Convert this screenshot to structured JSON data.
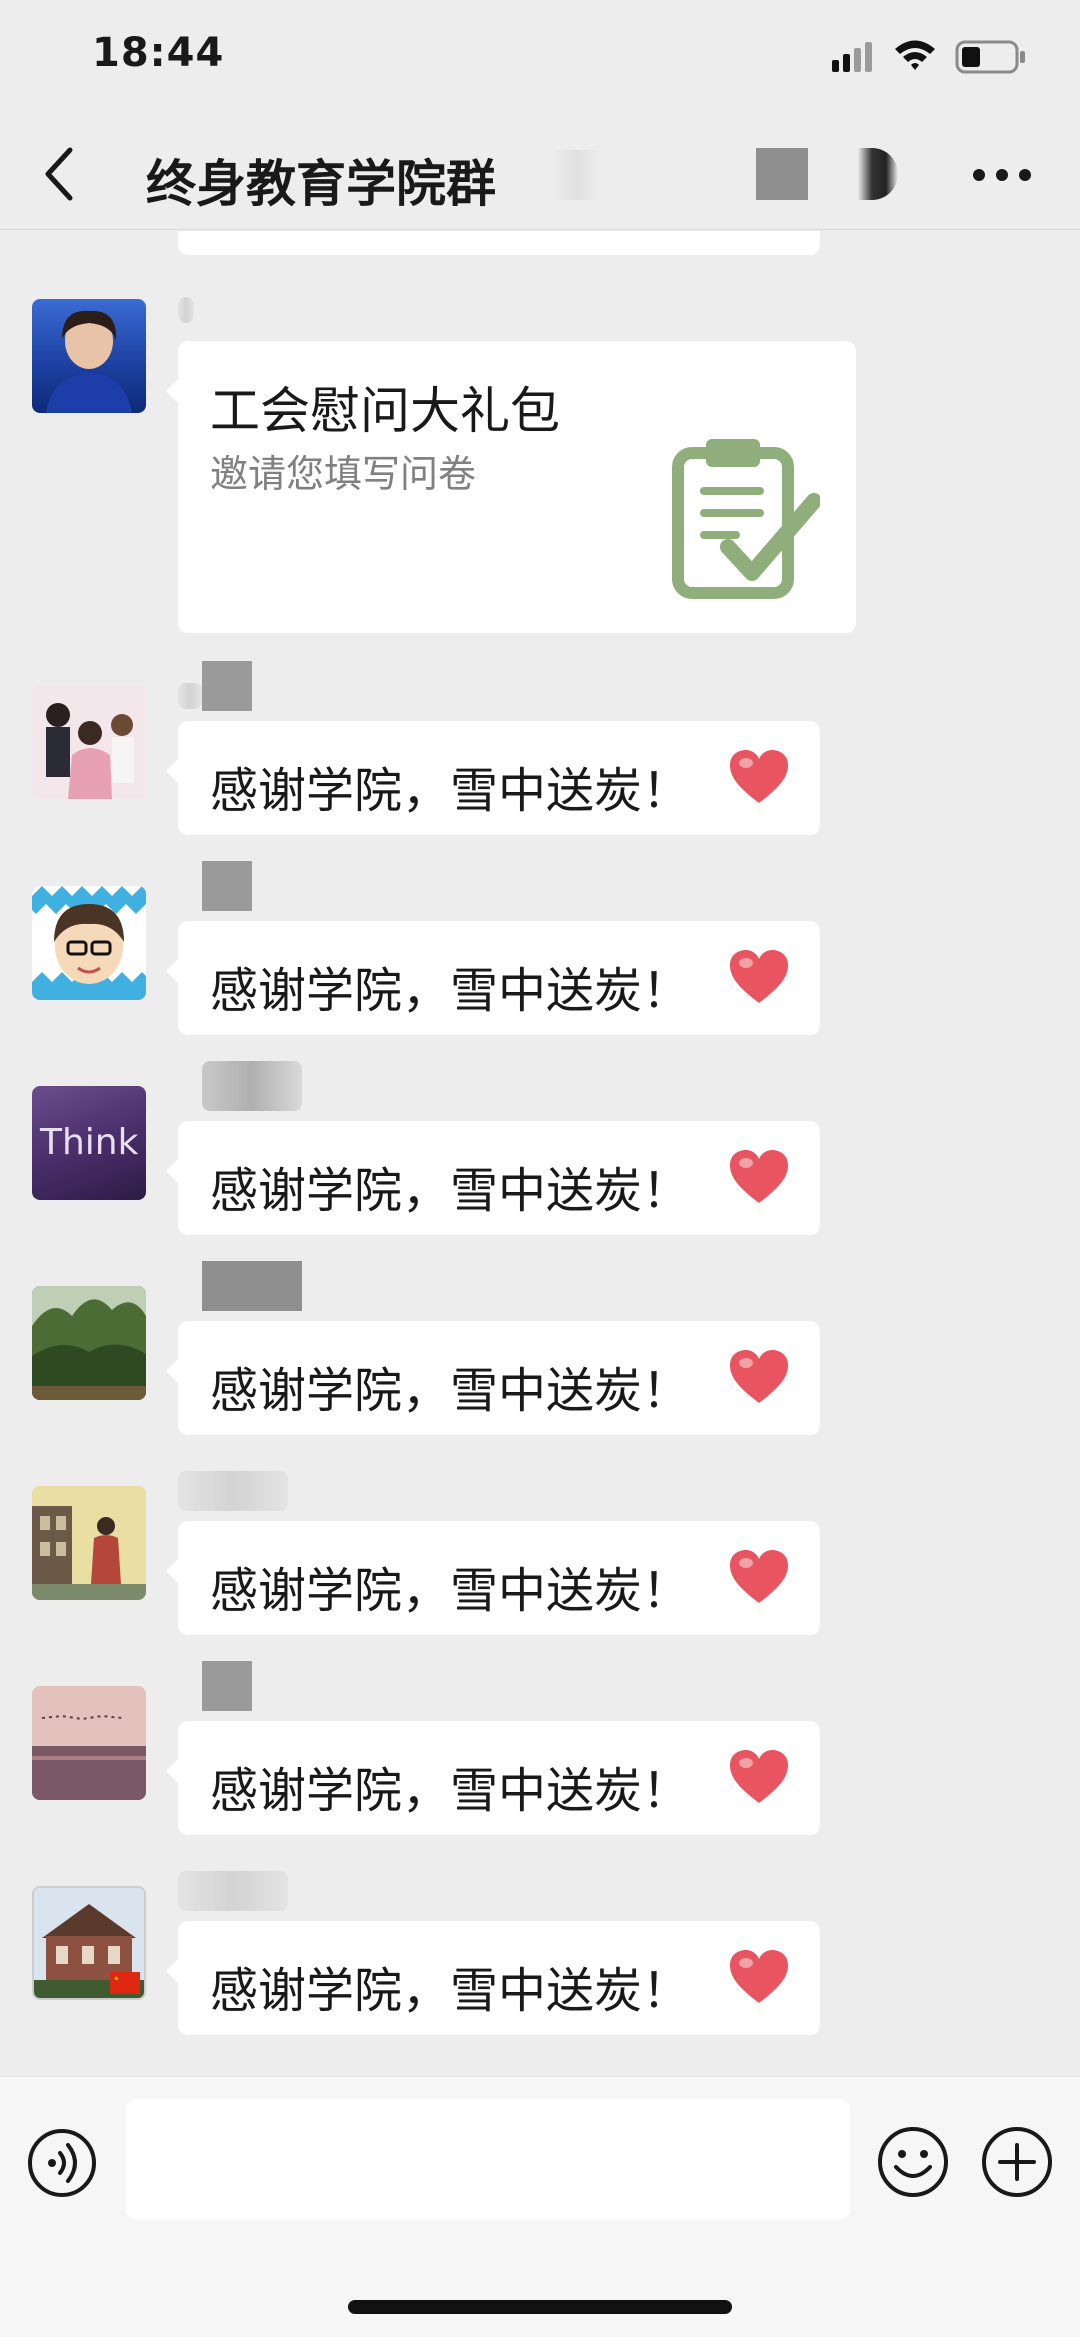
{
  "status_bar": {
    "time": "18:44"
  },
  "nav": {
    "title": "终身教育学院群"
  },
  "card_message": {
    "title": "工会慰问大礼包",
    "subtitle": "邀请您填写问卷",
    "icon": "clipboard-check-icon",
    "icon_color": "#8fae7c"
  },
  "messages": [
    {
      "text": "感谢学院，雪中送炭！",
      "emoji": "heart-icon"
    },
    {
      "text": "感谢学院，雪中送炭！",
      "emoji": "heart-icon"
    },
    {
      "text": "感谢学院，雪中送炭！",
      "emoji": "heart-icon",
      "avatar_text": "Think"
    },
    {
      "text": "感谢学院，雪中送炭！",
      "emoji": "heart-icon"
    },
    {
      "text": "感谢学院，雪中送炭！",
      "emoji": "heart-icon"
    },
    {
      "text": "感谢学院，雪中送炭！",
      "emoji": "heart-icon"
    },
    {
      "text": "感谢学院，雪中送炭！",
      "emoji": "heart-icon"
    }
  ],
  "colors": {
    "background": "#ededed",
    "bubble": "#ffffff",
    "heart": "#e8545f",
    "text": "#191919",
    "subtext": "#808080"
  }
}
